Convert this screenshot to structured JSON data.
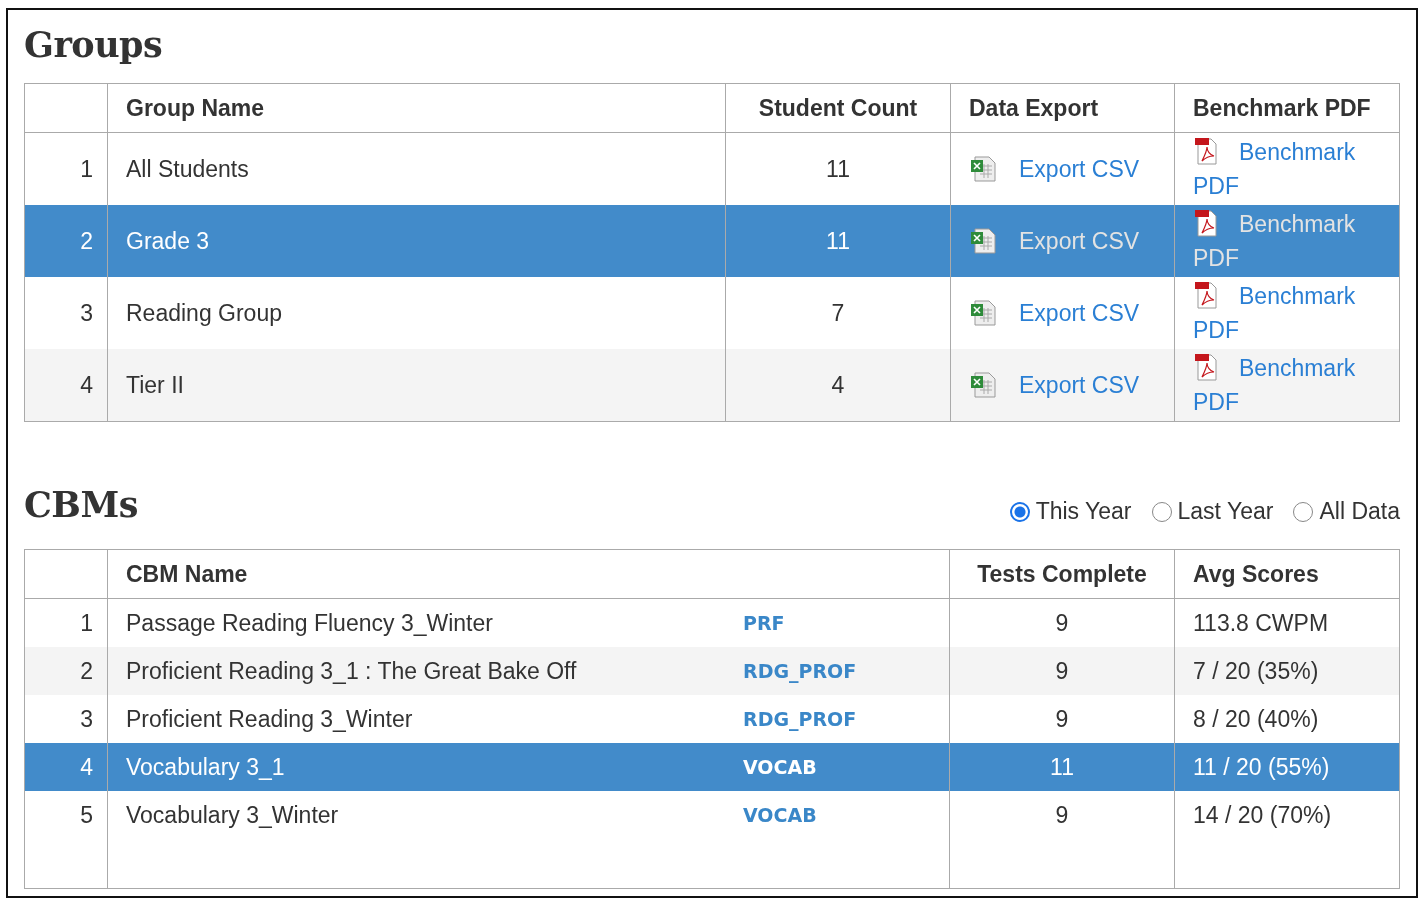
{
  "groups": {
    "title": "Groups",
    "columns": [
      "Group Name",
      "Student Count",
      "Data Export",
      "Benchmark PDF"
    ],
    "rows": [
      {
        "index": "1",
        "name": "All Students",
        "count": "11",
        "export": "Export CSV",
        "pdf": "Benchmark PDF",
        "selected": false
      },
      {
        "index": "2",
        "name": "Grade 3",
        "count": "11",
        "export": "Export CSV",
        "pdf": "Benchmark PDF",
        "selected": true
      },
      {
        "index": "3",
        "name": "Reading Group",
        "count": "7",
        "export": "Export CSV",
        "pdf": "Benchmark PDF",
        "selected": false
      },
      {
        "index": "4",
        "name": "Tier II",
        "count": "4",
        "export": "Export CSV",
        "pdf": "Benchmark PDF",
        "selected": false
      }
    ]
  },
  "cbms": {
    "title": "CBMs",
    "filters": [
      {
        "label": "This Year",
        "selected": true
      },
      {
        "label": "Last Year",
        "selected": false
      },
      {
        "label": "All Data",
        "selected": false
      }
    ],
    "columns": [
      "CBM Name",
      "Tests Complete",
      "Avg Scores"
    ],
    "rows": [
      {
        "index": "1",
        "name": "Passage Reading Fluency 3_Winter",
        "code": "PRF",
        "tests": "9",
        "avg": "113.8 CWPM",
        "selected": false
      },
      {
        "index": "2",
        "name": "Proficient Reading 3_1 : The Great Bake Off",
        "code": "RDG_PROF",
        "tests": "9",
        "avg": "7 / 20 (35%)",
        "selected": false
      },
      {
        "index": "3",
        "name": "Proficient Reading 3_Winter",
        "code": "RDG_PROF",
        "tests": "9",
        "avg": "8 / 20 (40%)",
        "selected": false
      },
      {
        "index": "4",
        "name": "Vocabulary 3_1",
        "code": "VOCAB",
        "tests": "11",
        "avg": "11 / 20 (55%)",
        "selected": true
      },
      {
        "index": "5",
        "name": "Vocabulary 3_Winter",
        "code": "VOCAB",
        "tests": "9",
        "avg": "14 / 20 (70%)",
        "selected": false
      }
    ]
  }
}
